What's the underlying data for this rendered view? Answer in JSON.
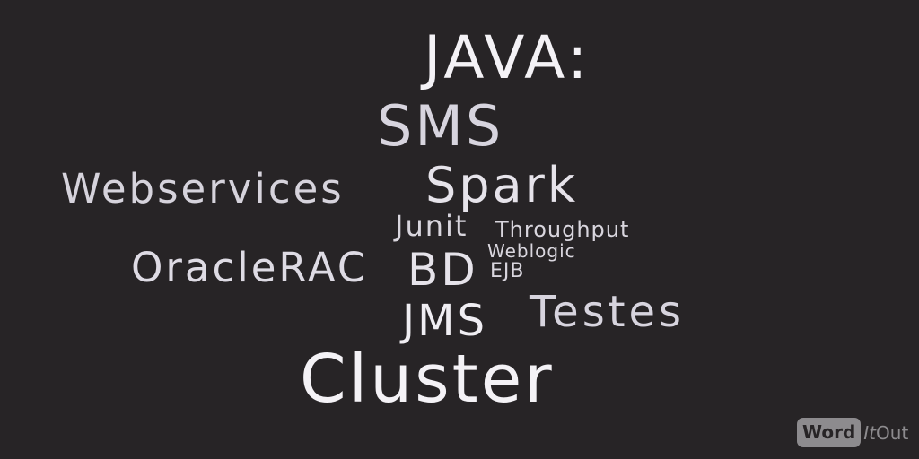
{
  "words": {
    "java": "JAVA:",
    "sms": "SMS",
    "webservices": "Webservices",
    "spark": "Spark",
    "junit": "Junit",
    "throughput": "Throughput",
    "weblogic": "Weblogic",
    "oraclerac": "OracleRAC",
    "bd": "BD",
    "ejb": "EJB",
    "testes": "Testes",
    "jms": "JMS",
    "cluster": "Cluster"
  },
  "logo": {
    "word": "Word",
    "it": "It",
    "out": "Out"
  },
  "colors": {
    "background": "#272426",
    "text": "#e6e3ea",
    "logo": "#8d8b8e"
  }
}
